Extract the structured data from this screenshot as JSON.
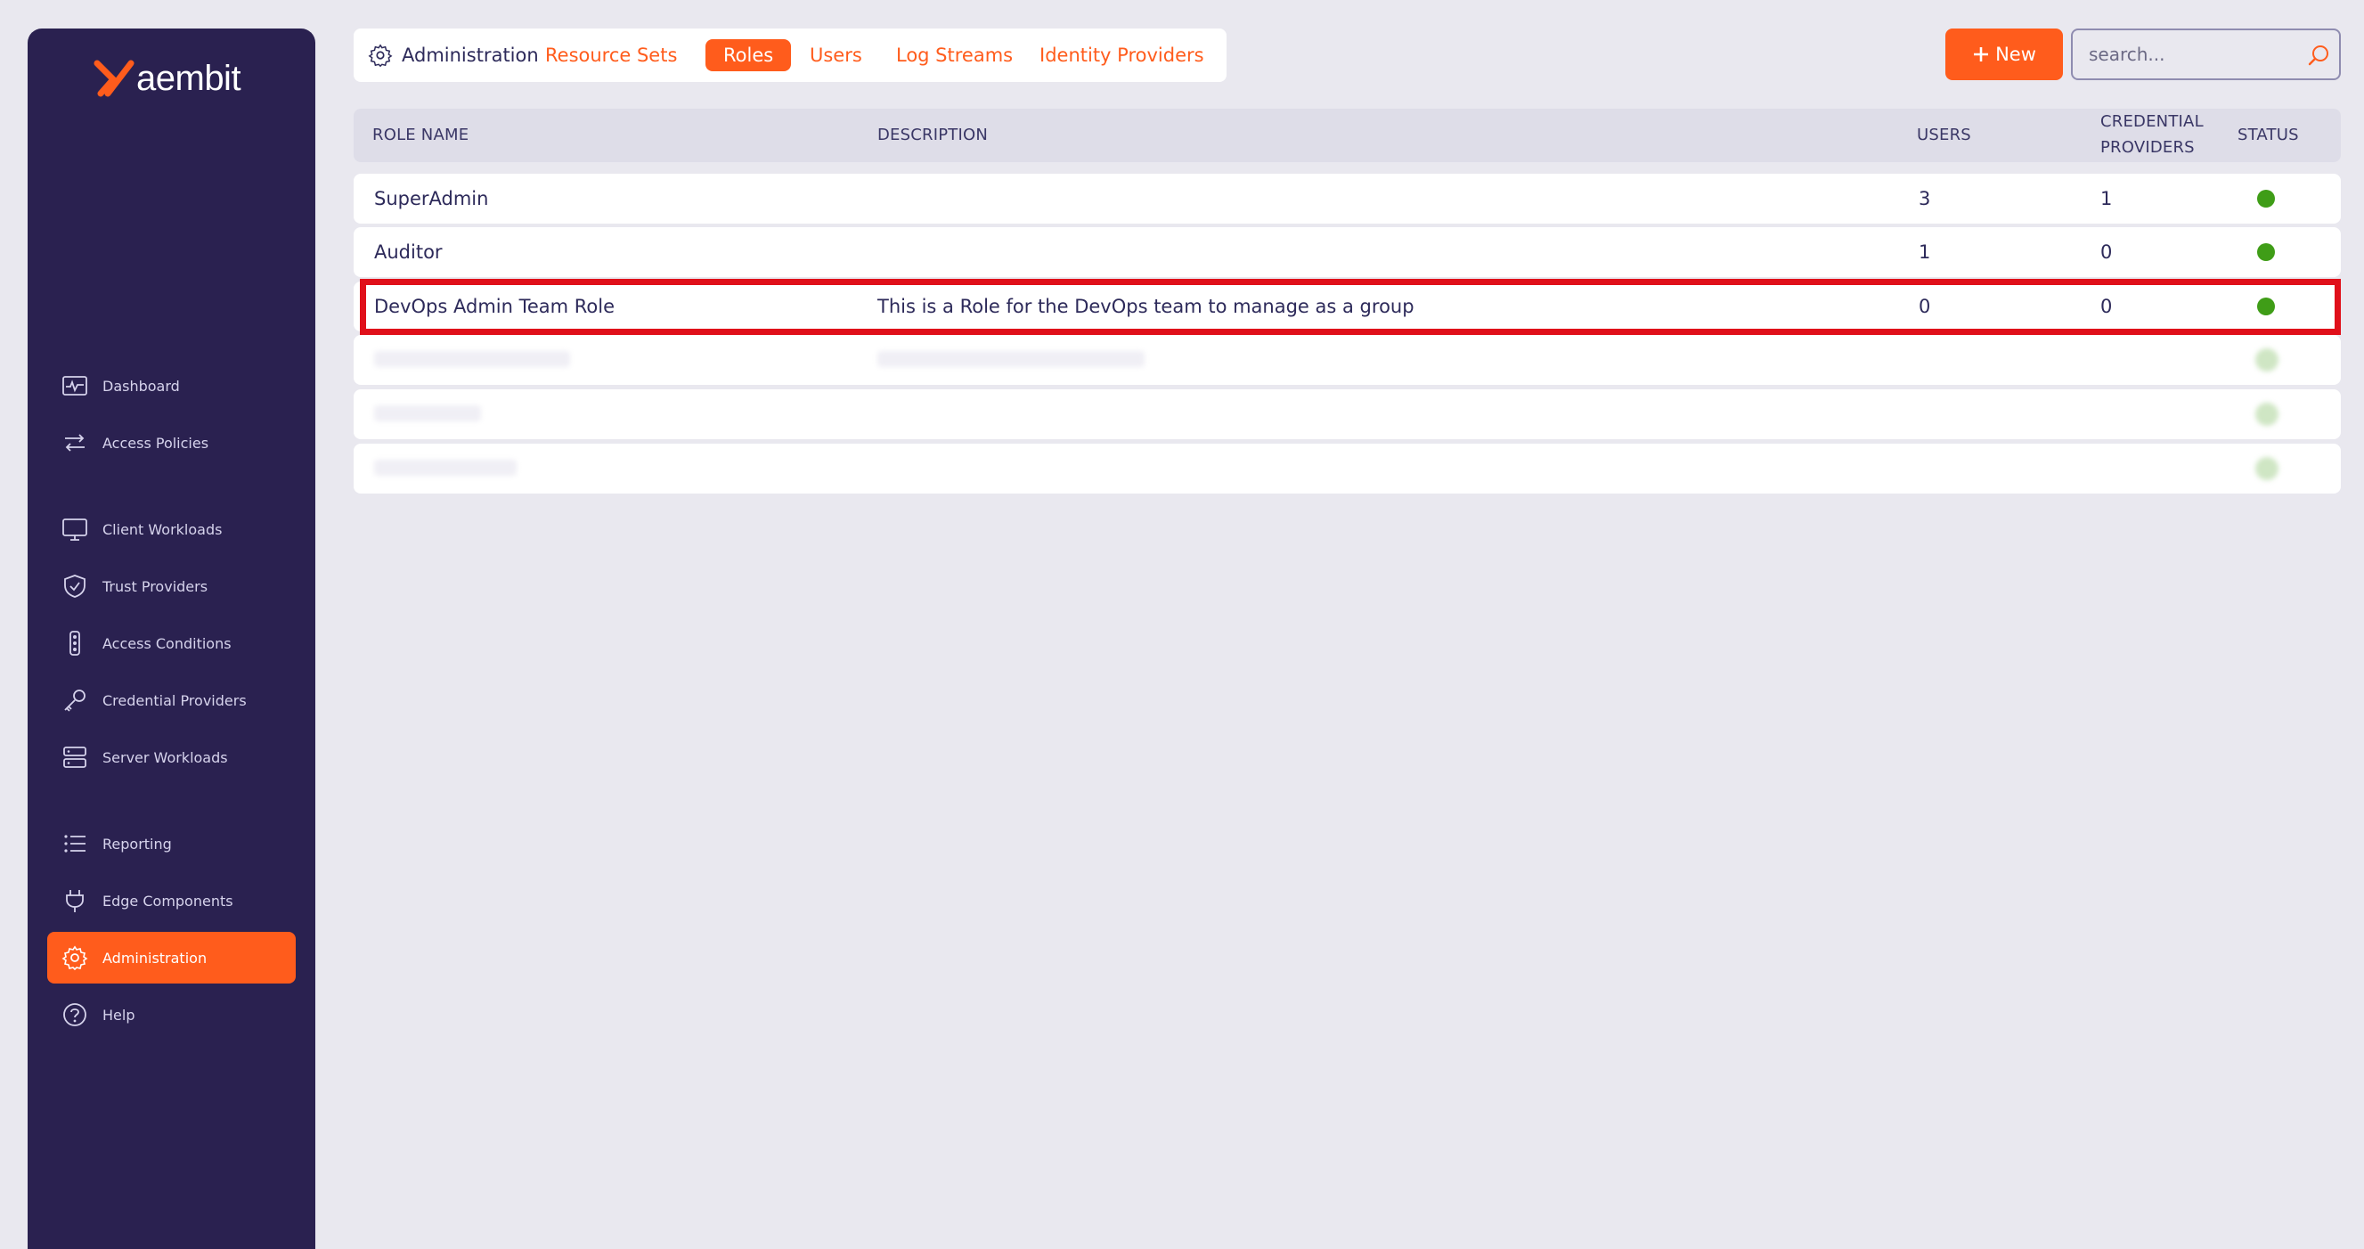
{
  "brand": {
    "name": "aembit"
  },
  "colors": {
    "accent": "#ff5c1c",
    "sidebar": "#2a2150",
    "status_active": "#3f9d17",
    "highlight": "#e0101a"
  },
  "sidebar": {
    "items": [
      {
        "label": "Dashboard",
        "icon": "chart-icon"
      },
      {
        "label": "Access Policies",
        "icon": "arrows-icon"
      },
      {
        "label": "Client Workloads",
        "icon": "monitor-icon"
      },
      {
        "label": "Trust Providers",
        "icon": "shield-icon"
      },
      {
        "label": "Access Conditions",
        "icon": "traffic-light-icon"
      },
      {
        "label": "Credential Providers",
        "icon": "key-icon"
      },
      {
        "label": "Server Workloads",
        "icon": "server-icon"
      },
      {
        "label": "Reporting",
        "icon": "list-icon"
      },
      {
        "label": "Edge Components",
        "icon": "plug-icon"
      },
      {
        "label": "Administration",
        "icon": "gear-icon",
        "active": true
      },
      {
        "label": "Help",
        "icon": "help-icon"
      }
    ]
  },
  "header": {
    "section": "Administration",
    "tabs": [
      {
        "label": "Resource Sets"
      },
      {
        "label": "Roles",
        "active": true
      },
      {
        "label": "Users"
      },
      {
        "label": "Log Streams"
      },
      {
        "label": "Identity Providers"
      }
    ],
    "new_label": "New",
    "search_placeholder": "search..."
  },
  "table": {
    "columns": [
      "ROLE NAME",
      "DESCRIPTION",
      "USERS",
      "CREDENTIAL\nPROVIDERS",
      "STATUS"
    ],
    "column_credential_line1": "CREDENTIAL",
    "column_credential_line2": "PROVIDERS",
    "rows": [
      {
        "name": "SuperAdmin",
        "description": "",
        "users": "3",
        "credential_providers": "1",
        "status": "active"
      },
      {
        "name": "Auditor",
        "description": "",
        "users": "1",
        "credential_providers": "0",
        "status": "active"
      },
      {
        "name": "DevOps Admin Team Role",
        "description": "This is a Role for the DevOps team to manage as a group",
        "users": "0",
        "credential_providers": "0",
        "status": "active",
        "highlighted": true
      }
    ]
  }
}
